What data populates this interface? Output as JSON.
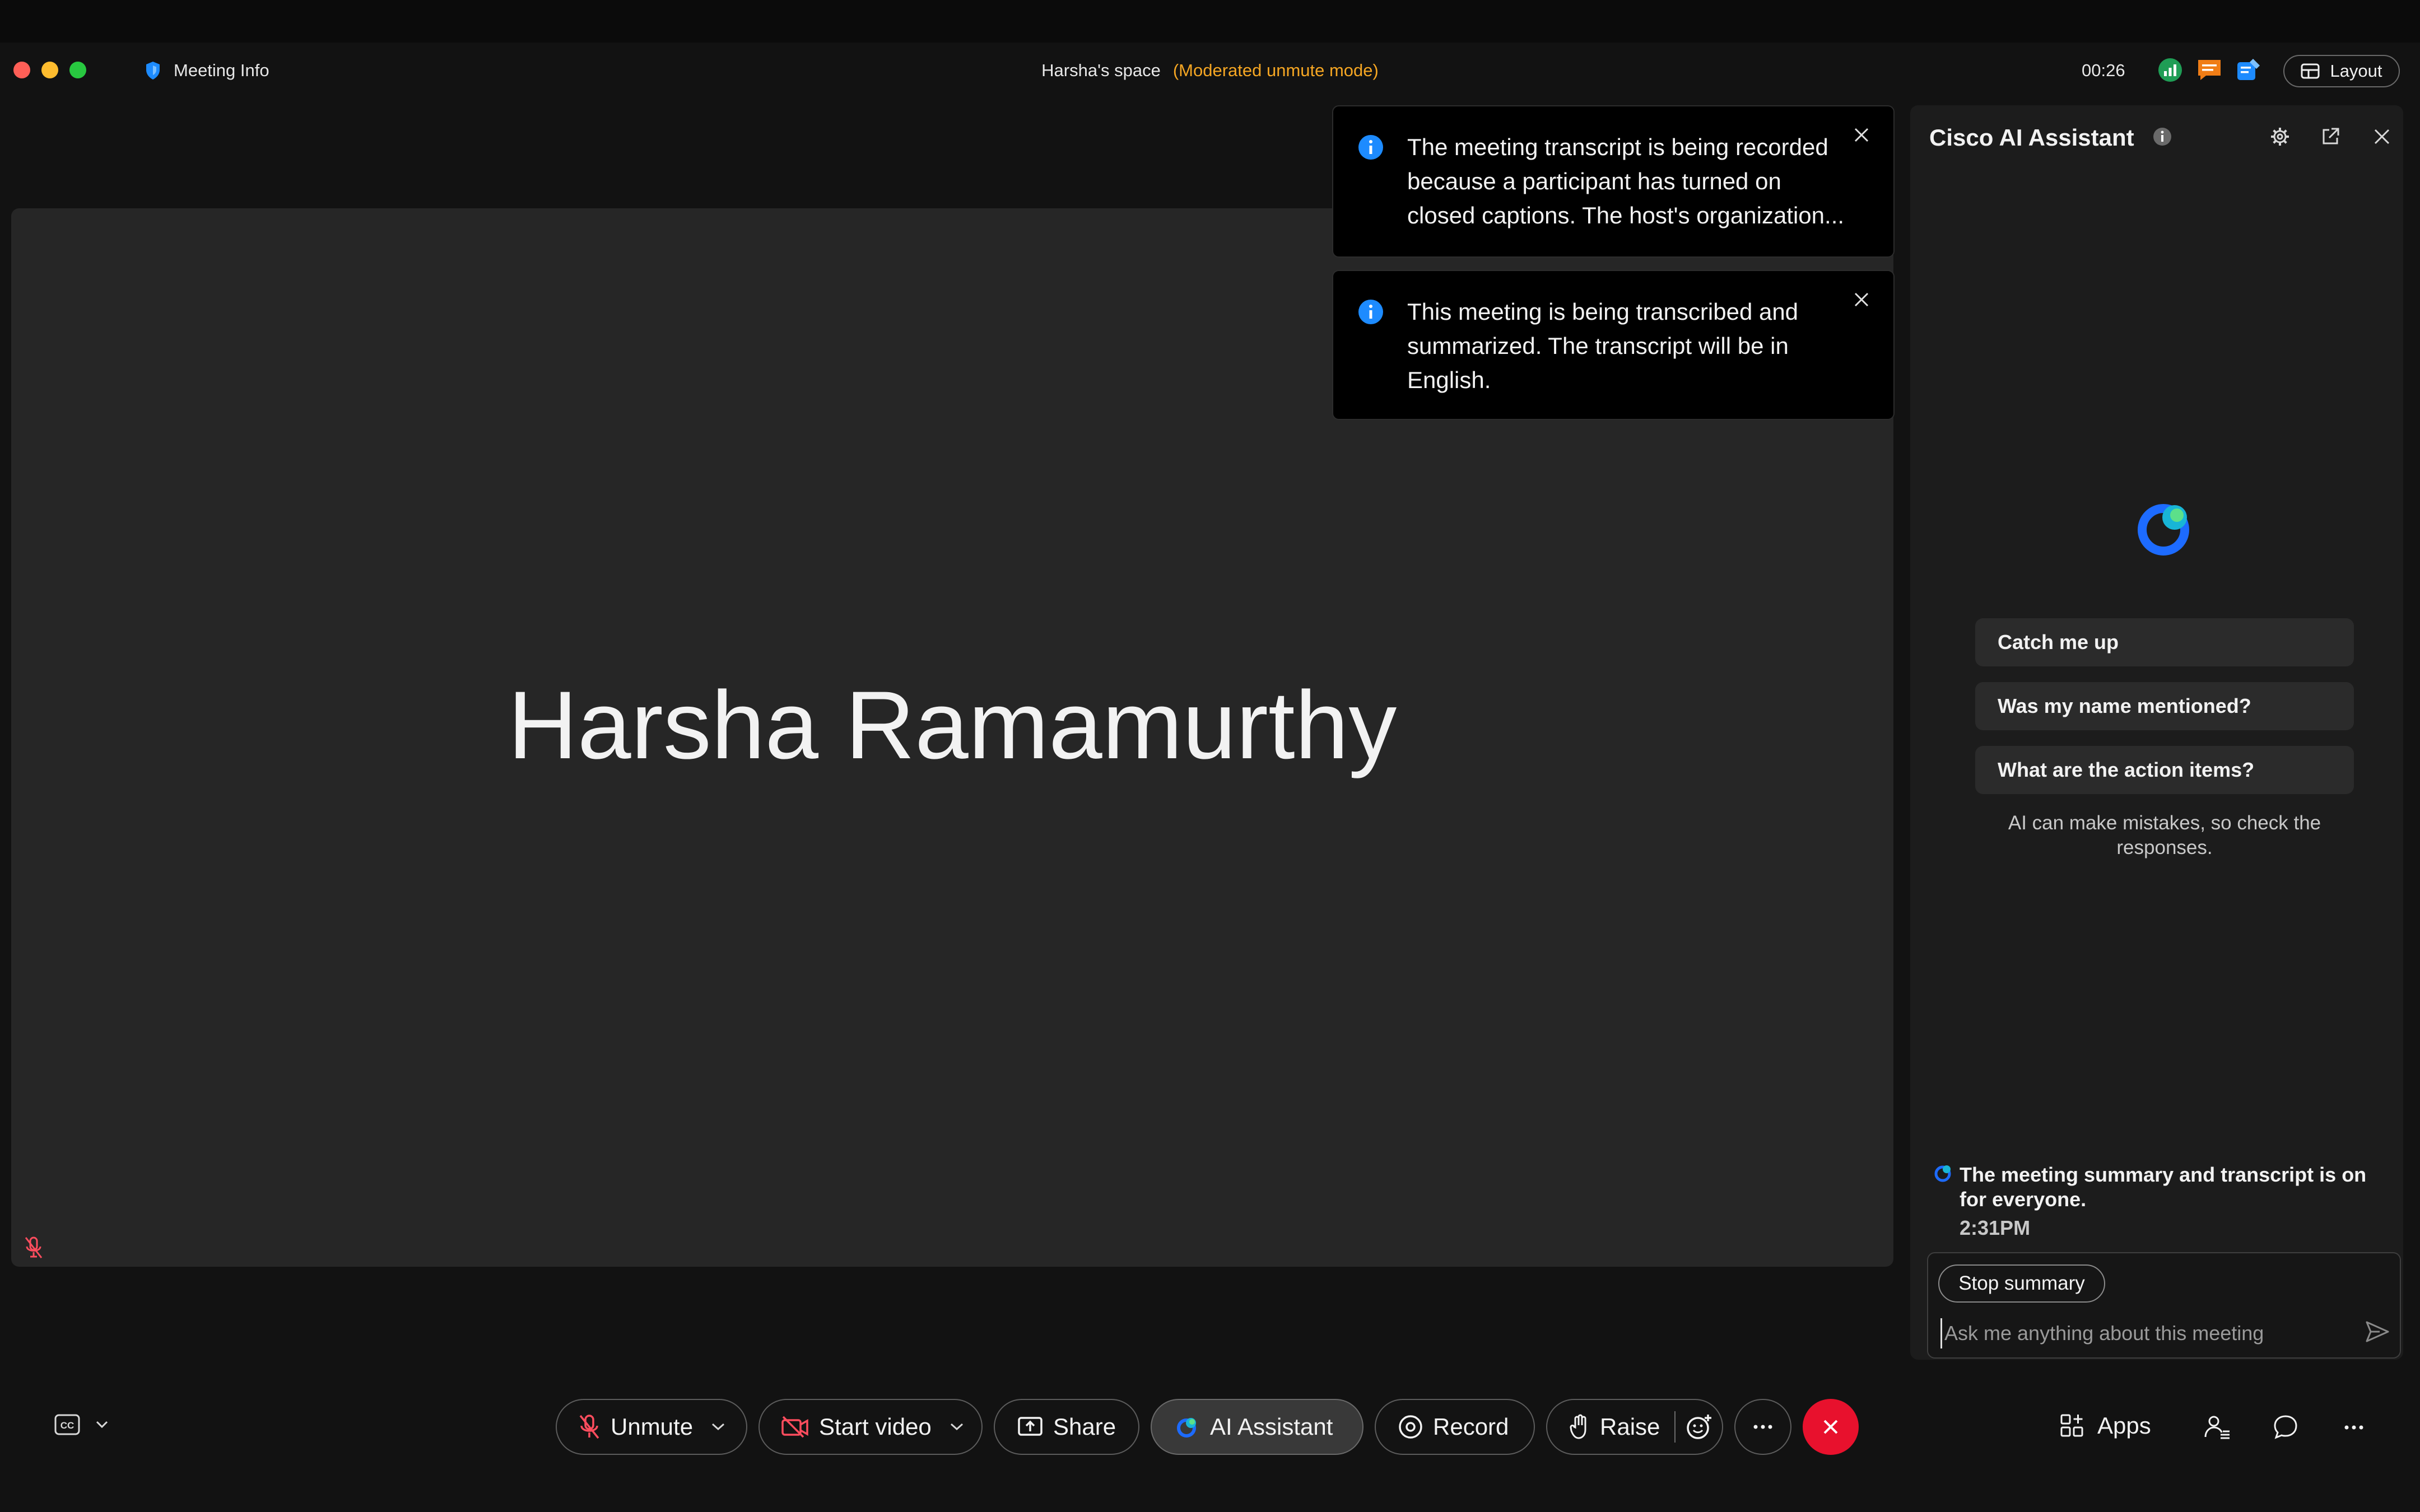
{
  "titlebar": {
    "meeting_info": "Meeting Info",
    "space_name": "Harsha's space",
    "mode": "(Moderated unmute mode)",
    "timer": "00:26",
    "layout_label": "Layout"
  },
  "stage": {
    "participant_name": "Harsha Ramamurthy"
  },
  "toasts": [
    {
      "text": "The meeting transcript is being recorded because a participant has turned on closed captions. The host's organization..."
    },
    {
      "text": "This meeting is being transcribed and summarized. The transcript will be in English."
    }
  ],
  "ai_panel": {
    "title": "Cisco AI Assistant",
    "chips": [
      "Catch me up",
      "Was my name mentioned?",
      "What are the action items?"
    ],
    "disclaimer": "AI can make mistakes, so check the responses.",
    "notice": "The meeting summary and transcript is on for everyone.",
    "notice_time": "2:31PM",
    "stop_label": "Stop summary",
    "input_placeholder": "Ask me anything about this meeting"
  },
  "toolbar": {
    "unmute": "Unmute",
    "start_video": "Start video",
    "share": "Share",
    "ai_assistant": "AI Assistant",
    "record": "Record",
    "raise": "Raise",
    "apps": "Apps"
  },
  "colors": {
    "mode_text": "#f5a623",
    "end_call": "#e8112d",
    "accent_blue": "#1d8bff",
    "mute_red": "#ff4d5e"
  },
  "icons": [
    "shield-icon",
    "signal-icon",
    "chat-bubble-icon",
    "edit-icon",
    "layout-icon",
    "info-icon",
    "close-icon",
    "gear-icon",
    "popout-icon",
    "ai-assistant-logo",
    "send-icon",
    "cc-icon",
    "mic-off-icon",
    "video-off-icon",
    "share-screen-icon",
    "record-icon",
    "hand-icon",
    "reaction-icon",
    "more-icon",
    "end-call-icon",
    "apps-icon",
    "participants-icon",
    "chat-icon"
  ]
}
